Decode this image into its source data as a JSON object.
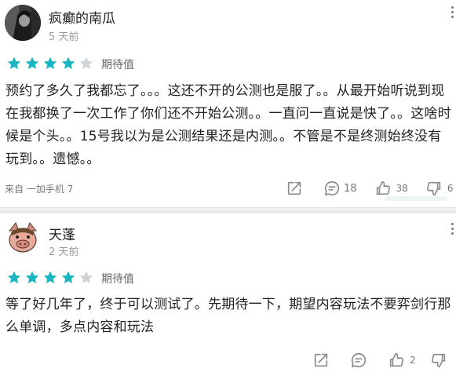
{
  "reviews": [
    {
      "user": "疯癫的南瓜",
      "time": "5 天前",
      "avatar_icon": "dark-character-avatar",
      "stars": 4,
      "rating_label": "期待值",
      "content": "预约了多久了我都忘了。。。这还不开的公测也是服了。。从最开始听说到现在我都换了一次工作了你们还不开始公测。。一直问一直说是快了。。这啥时候是个头。。15号我以为是公测结果还是内测。。不管是不是终测始终没有玩到。。遗憾。。",
      "device": "来自 一加手机 7",
      "replies": "18",
      "likes": "38",
      "dislikes": "6"
    },
    {
      "user": "天蓬",
      "time": "2 天前",
      "avatar_icon": "pig-avatar",
      "stars": 4,
      "rating_label": "期待值",
      "content": "等了好几年了，终于可以测试了。先期待一下，期望内容玩法不要弈剑行那么单调，多点内容和玩法",
      "likes": "2"
    }
  ],
  "colors": {
    "star_on": "#19b5c0",
    "star_off": "#cfd3d6",
    "icon": "#8a8a8a"
  }
}
